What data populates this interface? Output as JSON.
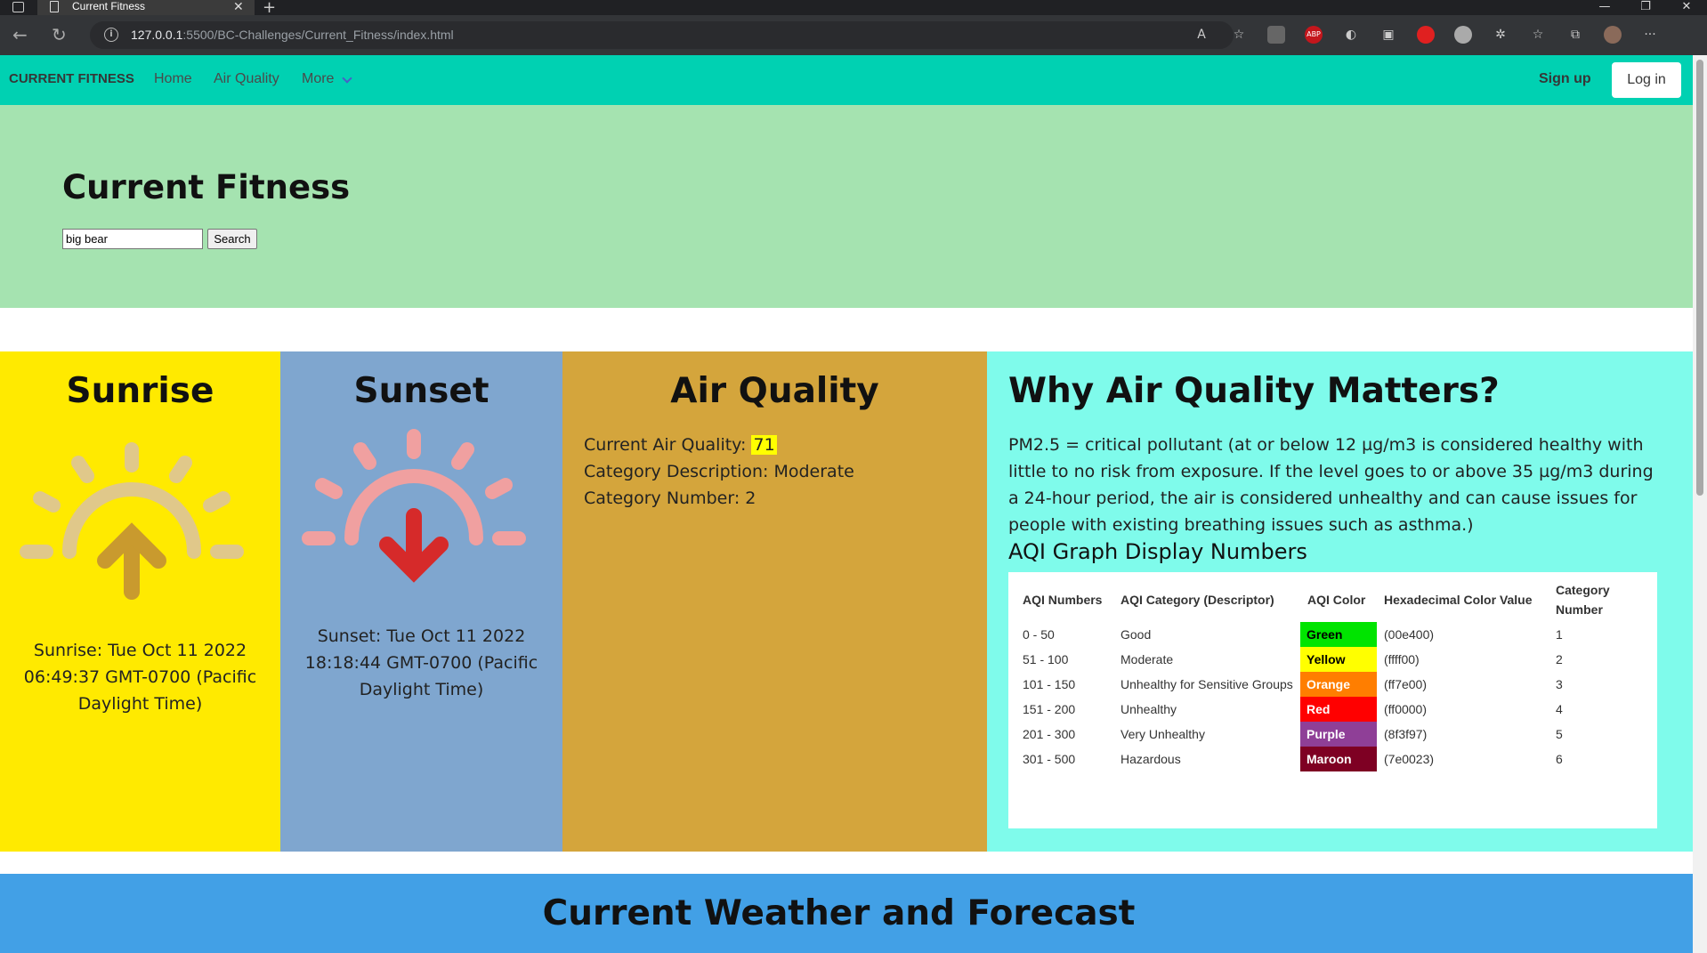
{
  "browser": {
    "tab_title": "Current Fitness",
    "url_host": "127.0.0.1",
    "url_rest": ":5500/BC-Challenges/Current_Fitness/index.html"
  },
  "navbar": {
    "brand": "CURRENT FITNESS",
    "links": [
      "Home",
      "Air Quality",
      "More"
    ],
    "signup": "Sign up",
    "login": "Log in",
    "background": "#00d1b2"
  },
  "hero": {
    "title": "Current Fitness",
    "search_value": "big bear",
    "search_button": "Search",
    "background": "#a5e3b0"
  },
  "sunrise": {
    "title": "Sunrise",
    "text": "Sunrise: Tue Oct 11 2022 06:49:37 GMT-0700 (Pacific Daylight Time)",
    "icon": "sunrise-icon",
    "background": "#ffea00"
  },
  "sunset": {
    "title": "Sunset",
    "text": "Sunset: Tue Oct 11 2022 18:18:44 GMT-0700 (Pacific Daylight Time)",
    "icon": "sunset-icon",
    "background": "#7fa6cf"
  },
  "air_quality": {
    "title": "Air Quality",
    "current_label": "Current Air Quality: ",
    "current_value": "71",
    "category_description": "Category Description: Moderate",
    "category_number": "Category Number: 2",
    "background": "#d4a53c"
  },
  "why": {
    "title": "Why Air Quality Matters?",
    "paragraph": "PM2.5 = critical pollutant (at or below 12 µg/m3 is considered healthy with little to no risk from exposure. If the level goes to or above 35 µg/m3 during a 24-hour period, the air is considered unhealthy and can cause issues for people with existing breathing issues such as asthma.)",
    "table_heading": "AQI Graph Display Numbers",
    "background": "#7ffbeb",
    "table": {
      "headers": [
        "AQI Numbers",
        "AQI Category (Descriptor)",
        "AQI Color",
        "Hexadecimal Color Value",
        "Category Number"
      ],
      "rows": [
        {
          "range": "0 - 50",
          "category": "Good",
          "color_name": "Green",
          "hex": "(00e400)",
          "number": "1",
          "color": "#00e400",
          "text_color": "#000000"
        },
        {
          "range": "51 - 100",
          "category": "Moderate",
          "color_name": "Yellow",
          "hex": "(ffff00)",
          "number": "2",
          "color": "#ffff00",
          "text_color": "#000000"
        },
        {
          "range": "101 - 150",
          "category": "Unhealthy for Sensitive Groups",
          "color_name": "Orange",
          "hex": "(ff7e00)",
          "number": "3",
          "color": "#ff7e00",
          "text_color": "#ffffff"
        },
        {
          "range": "151 - 200",
          "category": "Unhealthy",
          "color_name": "Red",
          "hex": "(ff0000)",
          "number": "4",
          "color": "#ff0000",
          "text_color": "#ffffff"
        },
        {
          "range": "201 - 300",
          "category": "Very Unhealthy",
          "color_name": "Purple",
          "hex": "(8f3f97)",
          "number": "5",
          "color": "#8f3f97",
          "text_color": "#ffffff"
        },
        {
          "range": "301 - 500",
          "category": "Hazardous",
          "color_name": "Maroon",
          "hex": "(7e0023)",
          "number": "6",
          "color": "#7e0023",
          "text_color": "#ffffff"
        }
      ]
    }
  },
  "weather": {
    "title": "Current Weather and Forecast",
    "background": "#42a0e6"
  }
}
